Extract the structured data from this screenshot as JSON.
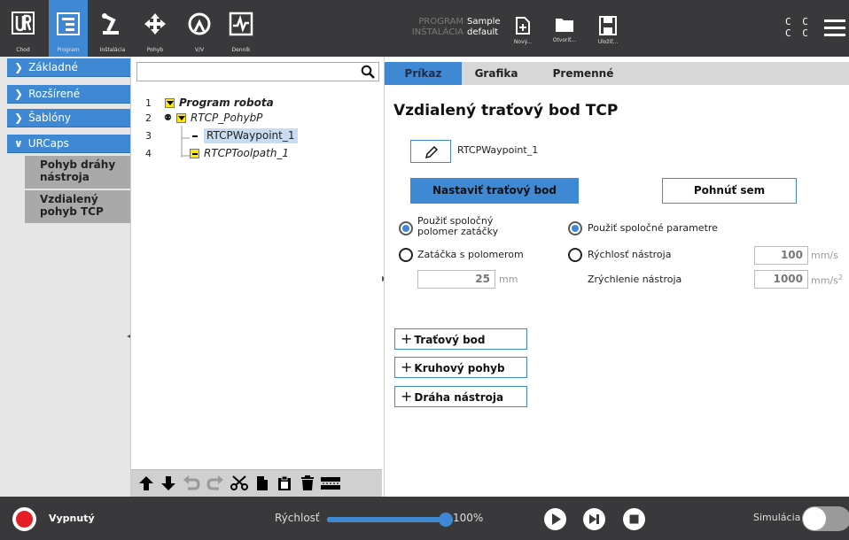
{
  "header": {
    "nav_buttons": [
      {
        "label": "Chod",
        "icon": "ur-logo-icon"
      },
      {
        "label": "Program",
        "icon": "program-tree-icon"
      },
      {
        "label": "Inštalácia",
        "icon": "robot-arm-icon"
      },
      {
        "label": "Pohyb",
        "icon": "move-arrows-icon"
      },
      {
        "label": "V/V",
        "icon": "io-gauge-icon"
      },
      {
        "label": "Denník",
        "icon": "log-chart-icon"
      }
    ],
    "program_key": "PROGRAM",
    "program_value": "Sample",
    "installation_key": "INŠTALÁCIA",
    "installation_value": "default",
    "file_buttons": [
      {
        "label": "Nový...",
        "icon": "new-file-icon"
      },
      {
        "label": "Otvoriť...",
        "icon": "open-folder-icon"
      },
      {
        "label": "Uložiť...",
        "icon": "save-icon"
      }
    ],
    "cc_line1": "C C",
    "cc_line2": "C C",
    "accent_color": "#3f88d4"
  },
  "leftnav": {
    "items": [
      {
        "label": "Základné",
        "chevron": ">"
      },
      {
        "label": "Rozšírené",
        "chevron": ">"
      },
      {
        "label": "Šablóny",
        "chevron": ">"
      },
      {
        "label": "URCaps",
        "chevron": "v"
      }
    ],
    "subitems": [
      {
        "label": "Pohyb dráhy nástroja"
      },
      {
        "label": "Vzdialený pohyb TCP"
      }
    ]
  },
  "tree": {
    "search_placeholder": "",
    "lines": [
      {
        "num": "1",
        "label": "Program robota"
      },
      {
        "num": "2",
        "label": "RTCP_PohybP"
      },
      {
        "num": "3",
        "label": "RTCPWaypoint_1"
      },
      {
        "num": "4",
        "label": "RTCPToolpath_1"
      }
    ]
  },
  "tabs": [
    "Príkaz",
    "Grafika",
    "Premenné"
  ],
  "content": {
    "title": "Vzdialený traťový bod TCP",
    "waypoint_name": "RTCPWaypoint_1",
    "set_waypoint_label": "Nastaviť traťový bod",
    "move_here_label": "Pohnúť sem",
    "radio_blend_shared_line1": "Použiť spoločný",
    "radio_blend_shared_line2": "polomer zatáčky",
    "radio_blend_radius": "Zatáčka s polomerom",
    "radio_shared_params": "Použiť spoločné parametre",
    "radio_tool_speed": "Rýchlosť nástroja",
    "tool_accel_label": "Zrýchlenie nástroja",
    "blend_radius_value": "25",
    "blend_radius_unit": "mm",
    "tool_speed_value": "100",
    "tool_speed_unit": "mm/s",
    "tool_accel_value": "1000",
    "tool_accel_unit": "mm/s",
    "tool_accel_unit_sup": "2",
    "add_waypoint": "Traťový bod",
    "add_circular": "Kruhový pohyb",
    "add_toolpath": "Dráha nástroja"
  },
  "footer": {
    "power_label": "Vypnutý",
    "speed_label": "Rýchlosť",
    "speed_value": "100%",
    "speed_fraction": 1.0,
    "simulation_label": "Simulácia"
  }
}
